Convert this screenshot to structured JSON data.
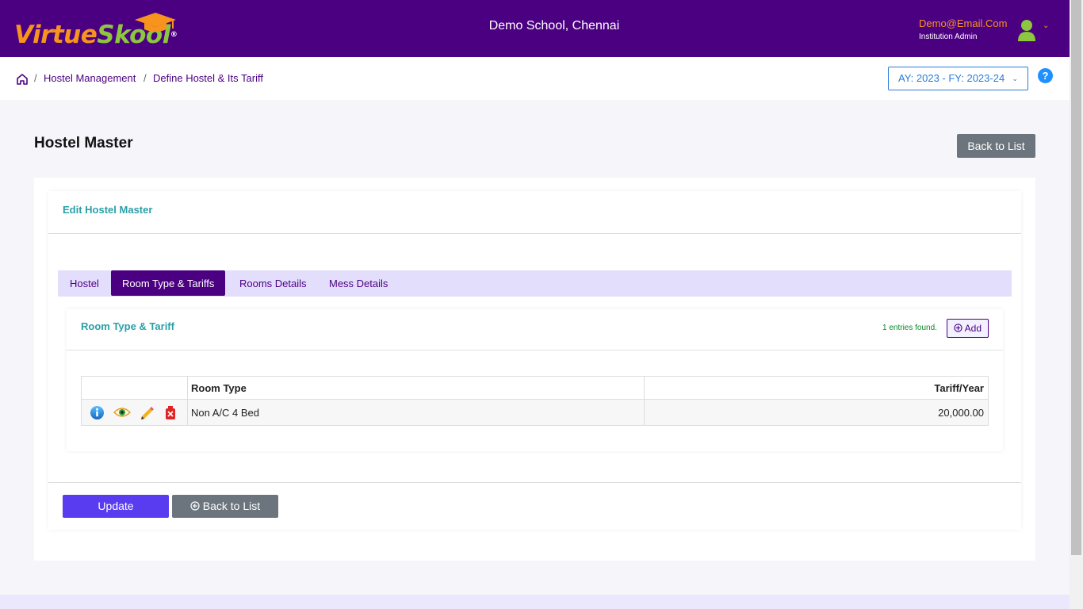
{
  "header": {
    "logo_part1": "Virtue",
    "logo_part2": "Skool",
    "logo_reg": "®",
    "school_name": "Demo School, Chennai",
    "user_email": "Demo@Email.Com",
    "user_role": "Institution Admin"
  },
  "breadcrumb": {
    "items": [
      "Hostel Management",
      "Define Hostel & Its Tariff"
    ],
    "separator": "/"
  },
  "ay_select": "AY: 2023 - FY: 2023-24",
  "help_label": "?",
  "page": {
    "title": "Hostel Master",
    "back_to_list": "Back to List"
  },
  "card": {
    "title": "Edit Hostel Master"
  },
  "tabs": [
    {
      "label": "Hostel",
      "active": false
    },
    {
      "label": "Room Type & Tariffs",
      "active": true
    },
    {
      "label": "Rooms Details",
      "active": false
    },
    {
      "label": "Mess Details",
      "active": false
    }
  ],
  "room_section": {
    "title": "Room Type & Tariff",
    "entries_found": "1 entries found.",
    "add_label": "Add",
    "columns": [
      "",
      "Room Type",
      "Tariff/Year"
    ],
    "rows": [
      {
        "room_type": "Non A/C 4 Bed",
        "tariff": "20,000.00"
      }
    ]
  },
  "footer_buttons": {
    "update": "Update",
    "back_to_list": "Back to List"
  },
  "colors": {
    "brand_purple": "#4b0082",
    "logo_orange": "#f7941d",
    "logo_green": "#8dc63f",
    "section_teal": "#2a9fa8",
    "update_button": "#5a3cf0"
  }
}
